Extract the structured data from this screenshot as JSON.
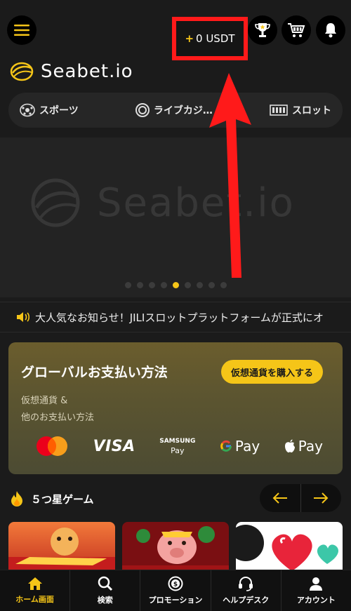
{
  "header": {
    "menu_icon": "hamburger-menu-icon",
    "balance_plus": "+",
    "balance_value": "0 USDT",
    "trophy_icon": "trophy-icon",
    "cart_icon": "cart-icon",
    "bell_icon": "bell-icon"
  },
  "brand": {
    "name": "Seabet.io"
  },
  "categories": [
    {
      "label": "スポーツ",
      "icon": "soccer-ball-icon"
    },
    {
      "label": "ライブカジ…",
      "icon": "casino-chip-icon"
    },
    {
      "label": "スロット",
      "icon": "slot-machine-icon"
    }
  ],
  "banner": {
    "watermark": "Seabet.io",
    "slides": 9,
    "active_slide": 5
  },
  "notice": {
    "text": "大人気なお知らせ！JILIスロットプラットフォームが正式にオ",
    "icon": "speaker-icon"
  },
  "payment": {
    "title": "グローバルお支払い方法",
    "buy_button": "仮想通貨を購入する",
    "sub_line1": "仮想通貨 &",
    "sub_line2": "他のお支払い方法",
    "methods": {
      "visa": "VISA",
      "samsung_top": "SAMSUNG",
      "samsung_bottom": "Pay",
      "gpay": "Pay",
      "apay": "Pay"
    }
  },
  "games": {
    "title": "５つ星ゲーム",
    "icon": "flame-icon"
  },
  "tabbar": [
    {
      "label": "ホーム画面",
      "icon": "home-icon",
      "active": true
    },
    {
      "label": "検索",
      "icon": "search-icon",
      "active": false
    },
    {
      "label": "プロモーション",
      "icon": "coin-icon",
      "active": false
    },
    {
      "label": "ヘルプデスク",
      "icon": "headset-icon",
      "active": false
    },
    {
      "label": "アカウント",
      "icon": "user-icon",
      "active": false
    }
  ],
  "colors": {
    "accent": "#f5c518",
    "highlight": "#ff1a1a",
    "background": "#1b1b1b"
  }
}
